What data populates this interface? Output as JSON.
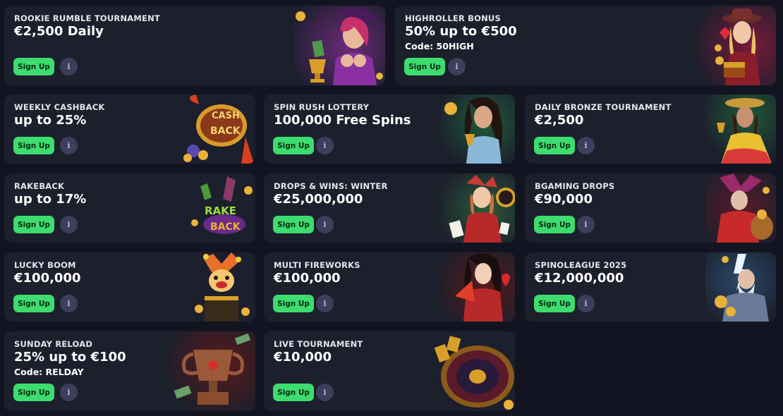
{
  "colors": {
    "page_bg": "#121521",
    "card_bg": "#1c1f2c",
    "signup_green": "#3ddc6e",
    "info_bg": "#3b3f5c"
  },
  "signup_label": "Sign Up",
  "info_label": "i",
  "promotions": [
    {
      "title": "ROOKIE RUMBLE TOURNAMENT",
      "amount": "€2,500 Daily",
      "code": "",
      "art": "witch-with-trophy"
    },
    {
      "title": "HIGHROLLER BONUS",
      "amount": "50% up to €500",
      "code": "Code: 50HIGH",
      "art": "cowgirl-with-chest"
    },
    {
      "title": "WEEKLY CASHBACK",
      "amount": "up to 25%",
      "code": "",
      "art": "cash-back-badge"
    },
    {
      "title": "SPIN RUSH LOTTERY",
      "amount": "100,000 Free Spins",
      "code": "",
      "art": "lady-with-goblet"
    },
    {
      "title": "DAILY BRONZE TOURNAMENT",
      "amount": "€2,500",
      "code": "",
      "art": "flamenco-lady"
    },
    {
      "title": "RAKEBACK",
      "amount": "up to 17%",
      "code": "",
      "art": "rake-back-badge"
    },
    {
      "title": "DROPS & WINS: WINTER",
      "amount": "€25,000,000",
      "code": "",
      "art": "jester-girl-with-cards"
    },
    {
      "title": "BGAMING DROPS",
      "amount": "€90,000",
      "code": "",
      "art": "jester-with-gold-bag"
    },
    {
      "title": "LUCKY BOOM",
      "amount": "€100,000",
      "code": "",
      "art": "jack-in-the-box"
    },
    {
      "title": "MULTI FIREWORKS",
      "amount": "€100,000",
      "code": "",
      "art": "geisha-with-fan"
    },
    {
      "title": "SPINOLEAGUE 2025",
      "amount": "€12,000,000",
      "code": "",
      "art": "zeus-with-lightning"
    },
    {
      "title": "SUNDAY RELOAD",
      "amount": "25% up to €100",
      "code": "Code: RELDAY",
      "art": "bronze-trophy-with-cash"
    },
    {
      "title": "LIVE TOURNAMENT",
      "amount": "€10,000",
      "code": "",
      "art": "roulette-wheel"
    }
  ]
}
